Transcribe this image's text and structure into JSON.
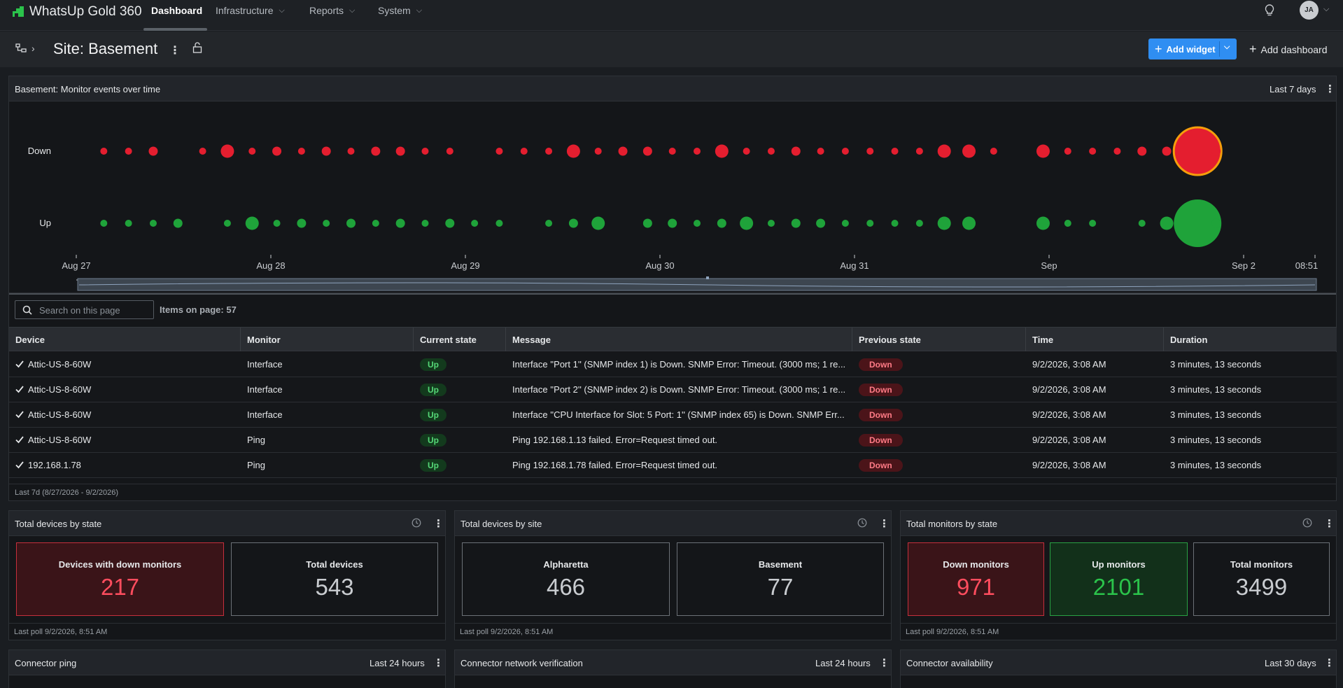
{
  "app": {
    "name": "WhatsUp Gold 360",
    "nav": [
      {
        "label": "Dashboard",
        "active": true
      },
      {
        "label": "Infrastructure",
        "has_menu": true
      },
      {
        "label": "Reports",
        "has_menu": true
      },
      {
        "label": "System",
        "has_menu": true
      }
    ],
    "user_initials": "JA"
  },
  "page": {
    "title": "Site: Basement",
    "add_widget_label": "Add widget",
    "add_dashboard_label": "Add dashboard"
  },
  "events_widget": {
    "title": "Basement: Monitor events over time",
    "range": "Last 7 days",
    "search_placeholder": "Search on this page",
    "items_on_page": "Items on page: 57",
    "footer": "Last 7d (8/27/2026 - 9/2/2026)",
    "colors": {
      "down": "#e41e2f",
      "up": "#1fa33a",
      "highlight": "#f59e0b"
    },
    "chart_data": {
      "type": "scatter",
      "categories": [
        "Down",
        "Up"
      ],
      "x_tick_labels": [
        "Aug 27",
        "Aug 28",
        "Aug 29",
        "Aug 30",
        "Aug 31",
        "Sep",
        "Sep 2",
        "08:51"
      ],
      "x_range": [
        "Aug 27 00:00",
        "Sep 2 08:51"
      ],
      "series": [
        {
          "name": "Down",
          "points": [
            {
              "t": 0.02,
              "s": 1
            },
            {
              "t": 0.04,
              "s": 1
            },
            {
              "t": 0.06,
              "s": 2
            },
            {
              "t": 0.1,
              "s": 1
            },
            {
              "t": 0.12,
              "s": 3
            },
            {
              "t": 0.14,
              "s": 1
            },
            {
              "t": 0.16,
              "s": 2
            },
            {
              "t": 0.18,
              "s": 1
            },
            {
              "t": 0.2,
              "s": 2
            },
            {
              "t": 0.22,
              "s": 1
            },
            {
              "t": 0.24,
              "s": 2
            },
            {
              "t": 0.26,
              "s": 2
            },
            {
              "t": 0.28,
              "s": 1
            },
            {
              "t": 0.3,
              "s": 1
            },
            {
              "t": 0.34,
              "s": 1
            },
            {
              "t": 0.36,
              "s": 1
            },
            {
              "t": 0.38,
              "s": 1
            },
            {
              "t": 0.4,
              "s": 3
            },
            {
              "t": 0.42,
              "s": 1
            },
            {
              "t": 0.44,
              "s": 2
            },
            {
              "t": 0.46,
              "s": 2
            },
            {
              "t": 0.48,
              "s": 1
            },
            {
              "t": 0.5,
              "s": 1
            },
            {
              "t": 0.52,
              "s": 3
            },
            {
              "t": 0.54,
              "s": 1
            },
            {
              "t": 0.56,
              "s": 1
            },
            {
              "t": 0.58,
              "s": 2
            },
            {
              "t": 0.6,
              "s": 1
            },
            {
              "t": 0.62,
              "s": 1
            },
            {
              "t": 0.64,
              "s": 1
            },
            {
              "t": 0.66,
              "s": 1
            },
            {
              "t": 0.68,
              "s": 1
            },
            {
              "t": 0.7,
              "s": 3
            },
            {
              "t": 0.72,
              "s": 3
            },
            {
              "t": 0.74,
              "s": 1
            },
            {
              "t": 0.78,
              "s": 3
            },
            {
              "t": 0.8,
              "s": 1
            },
            {
              "t": 0.82,
              "s": 1
            },
            {
              "t": 0.84,
              "s": 1
            },
            {
              "t": 0.86,
              "s": 2
            },
            {
              "t": 0.88,
              "s": 2
            },
            {
              "t": 0.905,
              "s": 9,
              "highlight": true
            },
            {
              "t": 0.92,
              "s": 2
            }
          ]
        },
        {
          "name": "Up",
          "points": [
            {
              "t": 0.02,
              "s": 1
            },
            {
              "t": 0.04,
              "s": 1
            },
            {
              "t": 0.06,
              "s": 1
            },
            {
              "t": 0.08,
              "s": 2
            },
            {
              "t": 0.12,
              "s": 1
            },
            {
              "t": 0.14,
              "s": 3
            },
            {
              "t": 0.16,
              "s": 1
            },
            {
              "t": 0.18,
              "s": 2
            },
            {
              "t": 0.2,
              "s": 1
            },
            {
              "t": 0.22,
              "s": 2
            },
            {
              "t": 0.24,
              "s": 1
            },
            {
              "t": 0.26,
              "s": 2
            },
            {
              "t": 0.28,
              "s": 1
            },
            {
              "t": 0.3,
              "s": 2
            },
            {
              "t": 0.32,
              "s": 1
            },
            {
              "t": 0.34,
              "s": 1
            },
            {
              "t": 0.38,
              "s": 1
            },
            {
              "t": 0.4,
              "s": 2
            },
            {
              "t": 0.42,
              "s": 3
            },
            {
              "t": 0.46,
              "s": 2
            },
            {
              "t": 0.48,
              "s": 2
            },
            {
              "t": 0.5,
              "s": 1
            },
            {
              "t": 0.52,
              "s": 2
            },
            {
              "t": 0.54,
              "s": 3
            },
            {
              "t": 0.56,
              "s": 1
            },
            {
              "t": 0.58,
              "s": 2
            },
            {
              "t": 0.6,
              "s": 2
            },
            {
              "t": 0.62,
              "s": 1
            },
            {
              "t": 0.64,
              "s": 1
            },
            {
              "t": 0.66,
              "s": 1
            },
            {
              "t": 0.68,
              "s": 1
            },
            {
              "t": 0.7,
              "s": 3
            },
            {
              "t": 0.72,
              "s": 3
            },
            {
              "t": 0.78,
              "s": 3
            },
            {
              "t": 0.8,
              "s": 1
            },
            {
              "t": 0.82,
              "s": 1
            },
            {
              "t": 0.86,
              "s": 1
            },
            {
              "t": 0.88,
              "s": 3
            },
            {
              "t": 0.9,
              "s": 1
            },
            {
              "t": 0.905,
              "s": 9
            },
            {
              "t": 0.92,
              "s": 2
            }
          ]
        }
      ]
    },
    "table": {
      "columns": [
        "Device",
        "Monitor",
        "Current state",
        "Message",
        "Previous state",
        "Time",
        "Duration"
      ],
      "rows": [
        {
          "device": "Attic-US-8-60W",
          "monitor": "Interface",
          "current": "Up",
          "message": "Interface ''Port 1'' (SNMP index 1) is Down. SNMP Error: Timeout. (3000 ms; 1 re...",
          "previous": "Down",
          "time": "9/2/2026, 3:08 AM",
          "duration": "3 minutes, 13 seconds"
        },
        {
          "device": "Attic-US-8-60W",
          "monitor": "Interface",
          "current": "Up",
          "message": "Interface ''Port 2'' (SNMP index 2) is Down. SNMP Error: Timeout. (3000 ms; 1 re...",
          "previous": "Down",
          "time": "9/2/2026, 3:08 AM",
          "duration": "3 minutes, 13 seconds"
        },
        {
          "device": "Attic-US-8-60W",
          "monitor": "Interface",
          "current": "Up",
          "message": "Interface ''CPU Interface for Slot: 5 Port: 1'' (SNMP index 65) is Down. SNMP Err...",
          "previous": "Down",
          "time": "9/2/2026, 3:08 AM",
          "duration": "3 minutes, 13 seconds"
        },
        {
          "device": "Attic-US-8-60W",
          "monitor": "Ping",
          "current": "Up",
          "message": "Ping 192.168.1.13 failed. Error=Request timed out.",
          "previous": "Down",
          "time": "9/2/2026, 3:08 AM",
          "duration": "3 minutes, 13 seconds"
        },
        {
          "device": "192.168.1.78",
          "monitor": "Ping",
          "current": "Up",
          "message": "Ping 192.168.1.78 failed. Error=Request timed out.",
          "previous": "Down",
          "time": "9/2/2026, 3:08 AM",
          "duration": "3 minutes, 13 seconds"
        }
      ]
    }
  },
  "stat_widgets": [
    {
      "title": "Total devices by state",
      "footer": "Last poll 9/2/2026, 8:51 AM",
      "tiles": [
        {
          "label": "Devices with down monitors",
          "value": "217",
          "tone": "red"
        },
        {
          "label": "Total devices",
          "value": "543",
          "tone": "neutral"
        }
      ]
    },
    {
      "title": "Total devices by site",
      "footer": "Last poll 9/2/2026, 8:51 AM",
      "tiles": [
        {
          "label": "Alpharetta",
          "value": "466",
          "tone": "neutral"
        },
        {
          "label": "Basement",
          "value": "77",
          "tone": "neutral"
        }
      ]
    },
    {
      "title": "Total monitors by state",
      "footer": "Last poll 9/2/2026, 8:51 AM",
      "tiles": [
        {
          "label": "Down monitors",
          "value": "971",
          "tone": "red"
        },
        {
          "label": "Up monitors",
          "value": "2101",
          "tone": "green"
        },
        {
          "label": "Total monitors",
          "value": "3499",
          "tone": "neutral"
        }
      ]
    }
  ],
  "bottom_widgets": [
    {
      "title": "Connector ping",
      "range": "Last 24 hours"
    },
    {
      "title": "Connector network verification",
      "range": "Last 24 hours"
    },
    {
      "title": "Connector availability",
      "range": "Last 30 days"
    }
  ]
}
